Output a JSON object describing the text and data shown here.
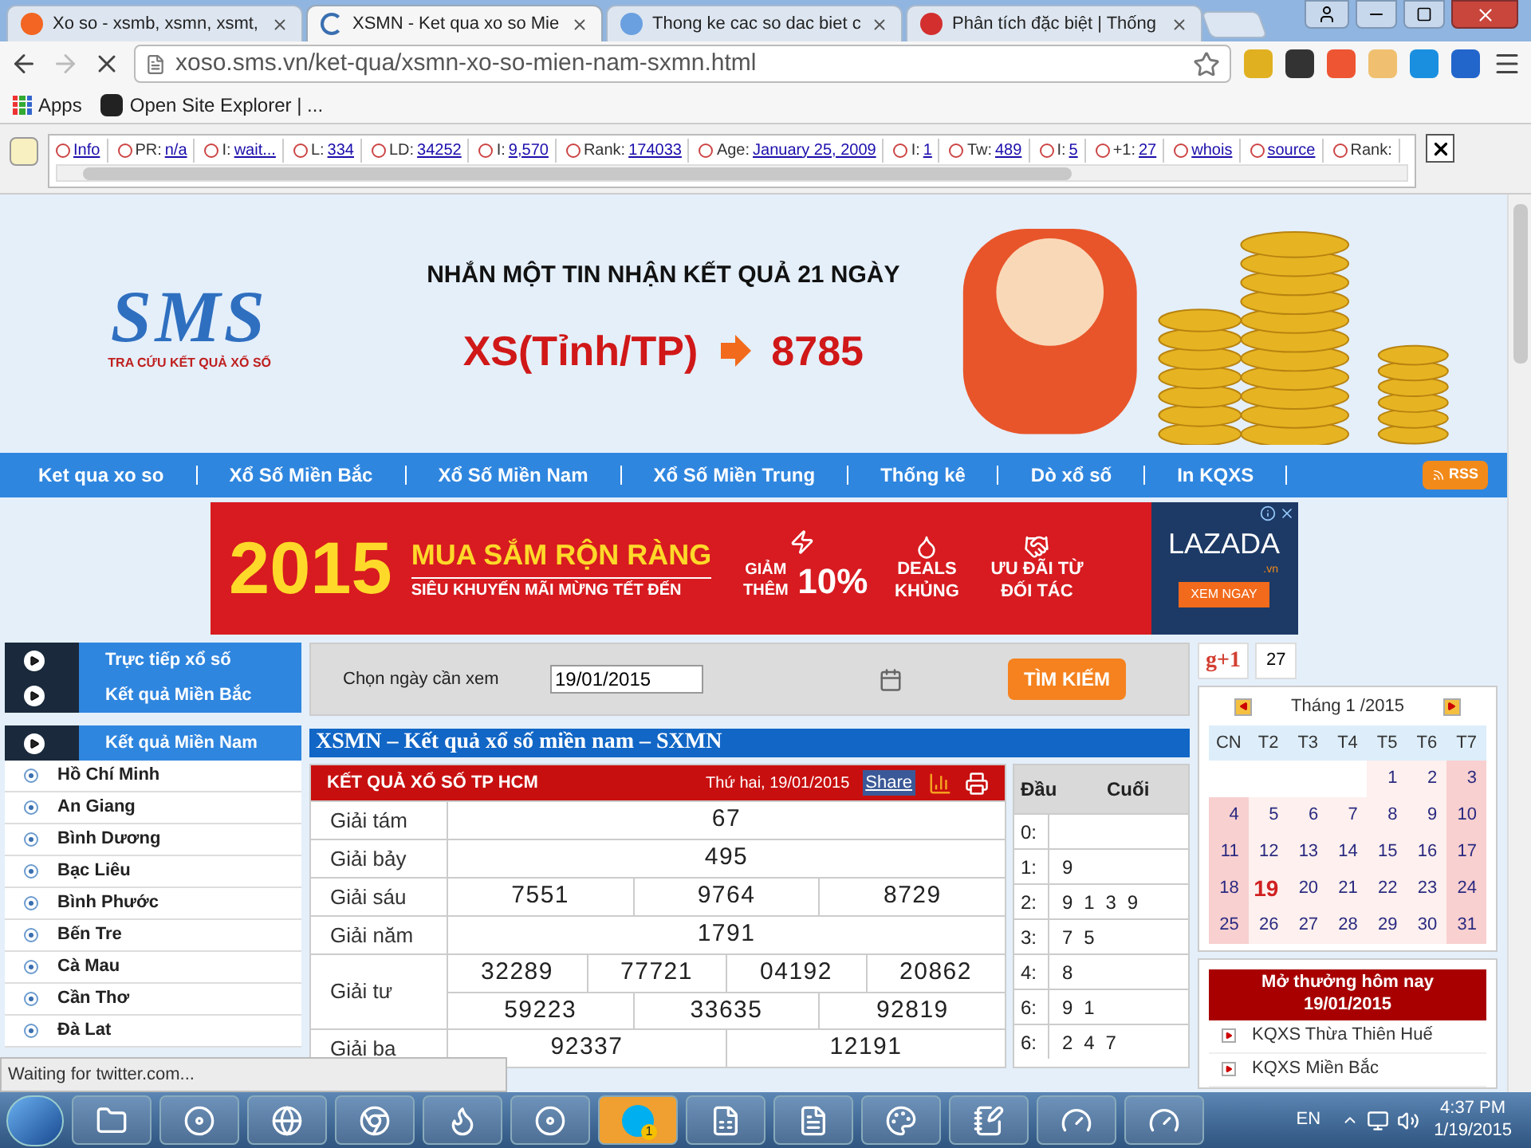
{
  "browser": {
    "tabs": [
      {
        "title": "Xo so - xsmb, xsmn, xsmt,",
        "selected": false
      },
      {
        "title": "XSMN - Ket qua xo so Mie",
        "selected": true
      },
      {
        "title": "Thong ke cac so dac biet c",
        "selected": false
      },
      {
        "title": "Phân tích đặc biệt | Thống",
        "selected": false
      }
    ],
    "url": "xoso.sms.vn/ket-qua/xsmn-xo-so-mien-nam-sxmn.html",
    "bookmarks": [
      "Apps",
      "Open Site Explorer | ..."
    ]
  },
  "seo_bar": [
    {
      "value": "Info"
    },
    {
      "label": "PR:",
      "value": "n/a"
    },
    {
      "label": "I:",
      "value": "wait..."
    },
    {
      "label": "L:",
      "value": "334"
    },
    {
      "label": "LD:",
      "value": "34252"
    },
    {
      "label": "I:",
      "value": "9,570"
    },
    {
      "label": "Rank:",
      "value": "174033"
    },
    {
      "label": "Age:",
      "value": "January 25, 2009"
    },
    {
      "label": "I:",
      "value": "1"
    },
    {
      "label": "Tw:",
      "value": "489"
    },
    {
      "label": "I:",
      "value": "5"
    },
    {
      "label": "+1:",
      "value": "27"
    },
    {
      "value": "whois"
    },
    {
      "value": "source"
    },
    {
      "label": "Rank:"
    }
  ],
  "header": {
    "logo": "SMS",
    "logo_tagline": "TRA CỨU KẾT QUẢ XỔ SỐ",
    "headline": "NHẮN MỘT TIN NHẬN KẾT QUẢ 21 NGÀY",
    "sms_code": "XS(Tỉnh/TP)",
    "sms_number": "8785"
  },
  "nav": {
    "items": [
      "Ket qua xo so",
      "Xổ Số Miền Bắc",
      "Xổ Số Miền Nam",
      "Xổ Số Miền Trung",
      "Thống kê",
      "Dò xổ số",
      "In KQXS"
    ],
    "rss": "RSS"
  },
  "ad": {
    "year": "2015",
    "headline": "MUA SẮM RỘN RÀNG",
    "subline": "SIÊU KHUYẾN MÃI MỪNG TẾT ĐẾN",
    "discount_label": "GIẢM THÊM",
    "discount": "10%",
    "deals": "DEALS KHỦNG",
    "partner": "ƯU ĐÃI TỪ ĐỐI TÁC",
    "brand": "LAZADA",
    "brand_suffix": ".vn",
    "cta": "XEM NGAY"
  },
  "sidebar": {
    "sections": [
      "Trực tiếp xổ số",
      "Kết quả Miền Bắc",
      "Kết quả Miền Nam"
    ],
    "provinces": [
      "Hồ Chí Minh",
      "An Giang",
      "Bình Dương",
      "Bạc Liêu",
      "Bình Phước",
      "Bến Tre",
      "Cà Mau",
      "Cần Thơ",
      "Đà Lat"
    ]
  },
  "search": {
    "label": "Chọn ngày cần xem",
    "date": "19/01/2015",
    "button": "TÌM KIẾM"
  },
  "results": {
    "section_title": "XSMN – Kết quả xổ số miền nam – SXMN",
    "title": "KẾT QUẢ XỔ SỐ TP HCM",
    "date": "Thứ hai, 19/01/2015",
    "share": "Share",
    "prizes": [
      {
        "name": "Giải tám",
        "lines": [
          [
            "67"
          ]
        ]
      },
      {
        "name": "Giải bảy",
        "lines": [
          [
            "495"
          ]
        ]
      },
      {
        "name": "Giải sáu",
        "lines": [
          [
            "7551",
            "9764",
            "8729"
          ]
        ]
      },
      {
        "name": "Giải năm",
        "lines": [
          [
            "1791"
          ]
        ]
      },
      {
        "name": "Giải tư",
        "lines": [
          [
            "32289",
            "77721",
            "04192",
            "20862"
          ],
          [
            "59223",
            "33635",
            "92819"
          ]
        ]
      },
      {
        "name": "Giải ba",
        "lines": [
          [
            "92337",
            "12191"
          ]
        ]
      }
    ]
  },
  "head_tail": {
    "columns": [
      "Đầu",
      "Cuối"
    ],
    "rows": [
      {
        "head": "0:"
      },
      {
        "head": "1:",
        "tail": "9"
      },
      {
        "head": "2:",
        "tail": "9 1 3 9"
      },
      {
        "head": "3:",
        "tail": "7 5"
      },
      {
        "head": "4:",
        "tail": "8"
      },
      {
        "head": "6:",
        "tail": "9 1"
      },
      {
        "head": "6:",
        "tail": "2 4 7"
      }
    ]
  },
  "social": {
    "plus_one": "g+1",
    "count": "27"
  },
  "calendar": {
    "month": "Tháng 1 /2015",
    "weekdays": [
      "CN",
      "T2",
      "T3",
      "T4",
      "T5",
      "T6",
      "T7"
    ],
    "weeks": [
      [
        {
          "kind": "blank"
        },
        {
          "kind": "blank"
        },
        {
          "kind": "blank"
        },
        {
          "kind": "blank"
        },
        {
          "kind": "day",
          "day": "1",
          "selected": false
        },
        {
          "kind": "day",
          "day": "2",
          "selected": false
        },
        {
          "kind": "day",
          "day": "3",
          "selected": false
        }
      ],
      [
        {
          "kind": "day",
          "day": "4",
          "selected": false
        },
        {
          "kind": "day",
          "day": "5",
          "selected": false
        },
        {
          "kind": "day",
          "day": "6",
          "selected": false
        },
        {
          "kind": "day",
          "day": "7",
          "selected": false
        },
        {
          "kind": "day",
          "day": "8",
          "selected": false
        },
        {
          "kind": "day",
          "day": "9",
          "selected": false
        },
        {
          "kind": "day",
          "day": "10",
          "selected": false
        }
      ],
      [
        {
          "kind": "day",
          "day": "11",
          "selected": false
        },
        {
          "kind": "day",
          "day": "12",
          "selected": false
        },
        {
          "kind": "day",
          "day": "13",
          "selected": false
        },
        {
          "kind": "day",
          "day": "14",
          "selected": false
        },
        {
          "kind": "day",
          "day": "15",
          "selected": false
        },
        {
          "kind": "day",
          "day": "16",
          "selected": false
        },
        {
          "kind": "day",
          "day": "17",
          "selected": false
        }
      ],
      [
        {
          "kind": "day",
          "day": "18",
          "selected": false
        },
        {
          "kind": "day",
          "day": "19",
          "selected": true
        },
        {
          "kind": "day",
          "day": "20",
          "selected": false
        },
        {
          "kind": "day",
          "day": "21",
          "selected": false
        },
        {
          "kind": "day",
          "day": "22",
          "selected": false
        },
        {
          "kind": "day",
          "day": "23",
          "selected": false
        },
        {
          "kind": "day",
          "day": "24",
          "selected": false
        }
      ],
      [
        {
          "kind": "day",
          "day": "25",
          "selected": false
        },
        {
          "kind": "day",
          "day": "26",
          "selected": false
        },
        {
          "kind": "day",
          "day": "27",
          "selected": false
        },
        {
          "kind": "day",
          "day": "28",
          "selected": false
        },
        {
          "kind": "day",
          "day": "29",
          "selected": false
        },
        {
          "kind": "day",
          "day": "30",
          "selected": false
        },
        {
          "kind": "day",
          "day": "31",
          "selected": false
        }
      ]
    ]
  },
  "today": {
    "title": "Mở thưởng hôm nay",
    "date": "19/01/2015",
    "items": [
      "KQXS Thừa Thiên Huế",
      "KQXS Miền Bắc"
    ]
  },
  "status_bar": "Waiting for twitter.com...",
  "taskbar": {
    "skype_badge": "1",
    "language": "EN",
    "time": "4:37 PM",
    "date": "1/19/2015"
  }
}
